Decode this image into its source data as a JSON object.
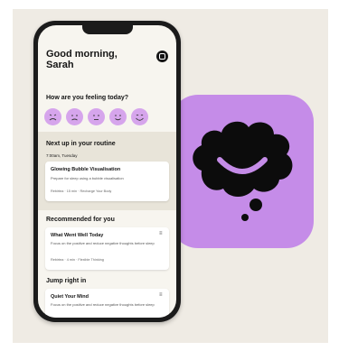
{
  "greeting": {
    "line1": "Good morning,",
    "line2": "Sarah"
  },
  "mood": {
    "question": "How are you feeling today?",
    "faces": [
      "very-sad-face-icon",
      "sad-face-icon",
      "neutral-face-icon",
      "happy-face-icon",
      "very-happy-face-icon"
    ]
  },
  "routine": {
    "heading": "Next up in your routine",
    "time": "7:00am, Tuesday",
    "card": {
      "title": "Glowing Bubble Visualisation",
      "subtitle": "Prepare for sleep using a bubble visualisation",
      "meta": "Rebirtea · 15 min · Recharge Your Body"
    }
  },
  "recommended": {
    "heading": "Recommended for you",
    "card": {
      "title": "What Went Well Today",
      "text": "Focus on the positive and reduce negative thoughts before sleep",
      "meta": "Rebirtea · 4 min · Flexible Thinking"
    }
  },
  "jump": {
    "heading": "Jump right in",
    "card": {
      "title": "Quiet Your Mind",
      "text": "Focus on the positive and reduce negative thoughts before sleep"
    }
  },
  "colors": {
    "accent": "#c58ce8",
    "mood": "#d6a5ec",
    "background": "#efebe4"
  },
  "app_icon": "smiling-brain-icon"
}
